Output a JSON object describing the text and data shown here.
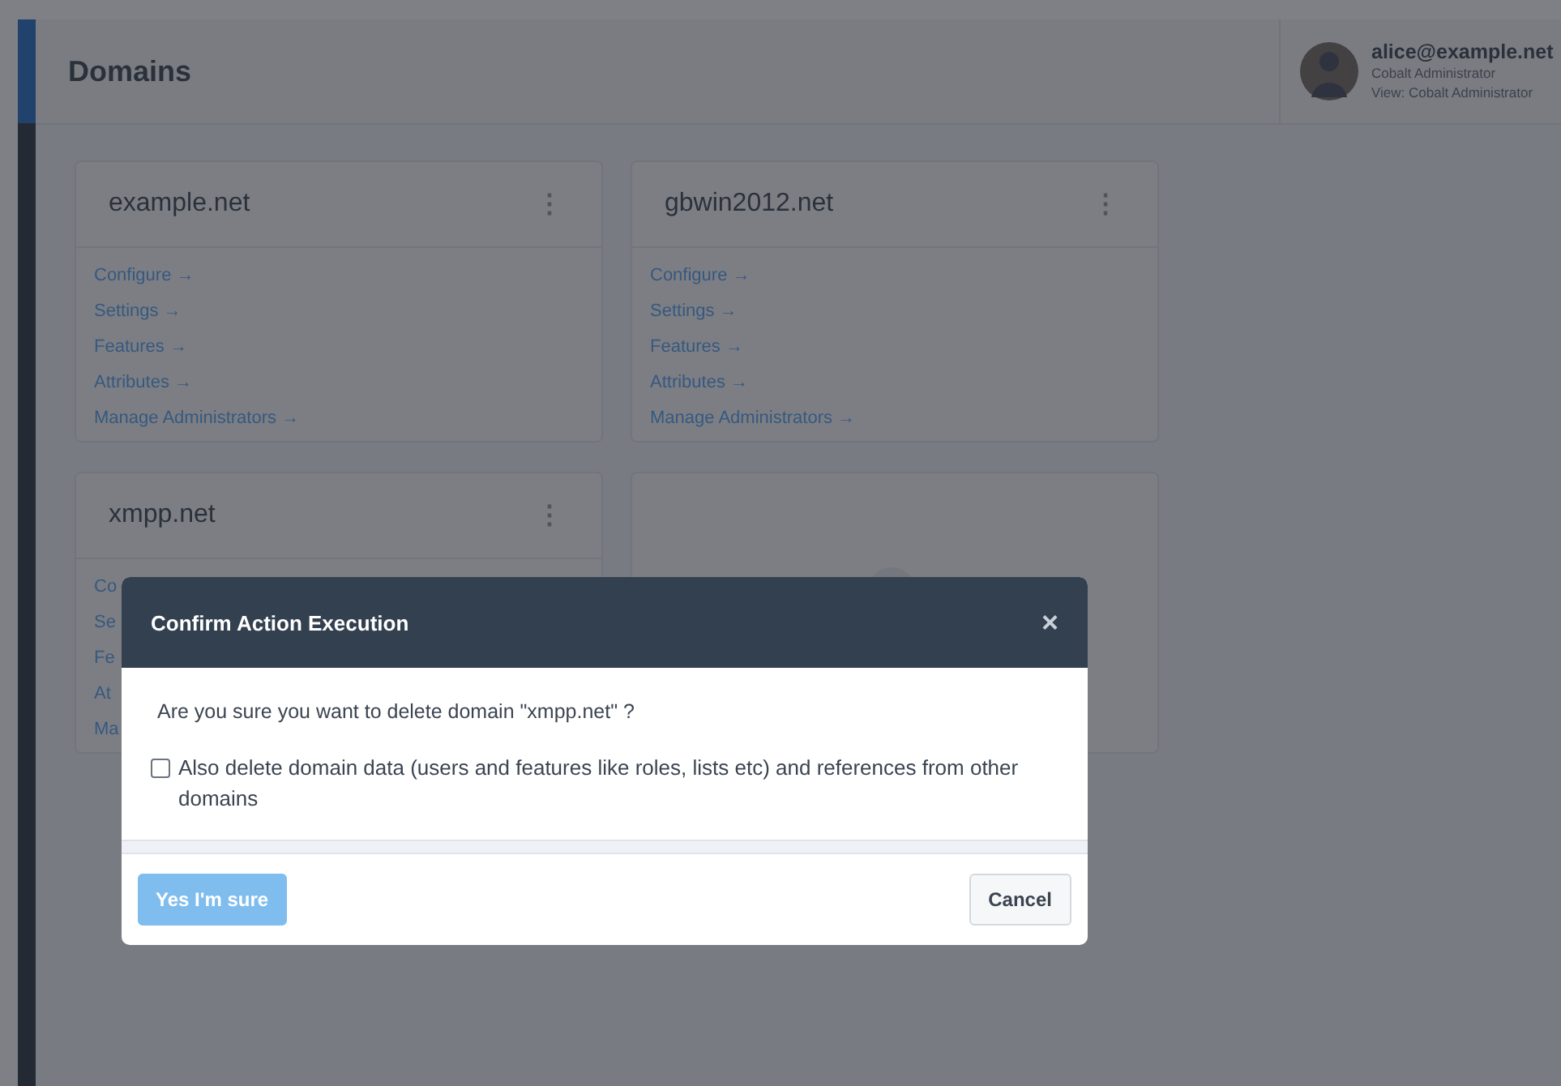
{
  "page": {
    "title": "Domains"
  },
  "user": {
    "email": "alice@example.net",
    "role": "Cobalt Administrator",
    "view": "View: Cobalt Administrator"
  },
  "domains": [
    {
      "kind": "domain",
      "name": "example.net",
      "menu_icon": "⋮",
      "links": [
        "Configure →",
        "Settings →",
        "Features →",
        "Attributes →",
        "Manage Administrators →"
      ]
    },
    {
      "kind": "domain",
      "name": "gbwin2012.net",
      "menu_icon": "⋮",
      "links": [
        "Configure →",
        "Settings →",
        "Features →",
        "Attributes →",
        "Manage Administrators →"
      ]
    },
    {
      "kind": "domain",
      "name": "xmpp.net",
      "menu_icon": "⋮",
      "links": [
        "Co",
        "Se",
        "Fe",
        "At",
        "Ma"
      ]
    },
    {
      "kind": "loading"
    }
  ],
  "dialog": {
    "title": "Confirm Action Execution",
    "close": "×",
    "message": "Are you sure you want to delete domain \"xmpp.net\" ?",
    "option": {
      "label": "Also delete domain data (users and features like roles, lists etc) and references from other domains",
      "checked": false
    },
    "confirm": {
      "label": "Yes I'm sure",
      "disabled": true
    },
    "cancel": {
      "label": "Cancel"
    }
  }
}
